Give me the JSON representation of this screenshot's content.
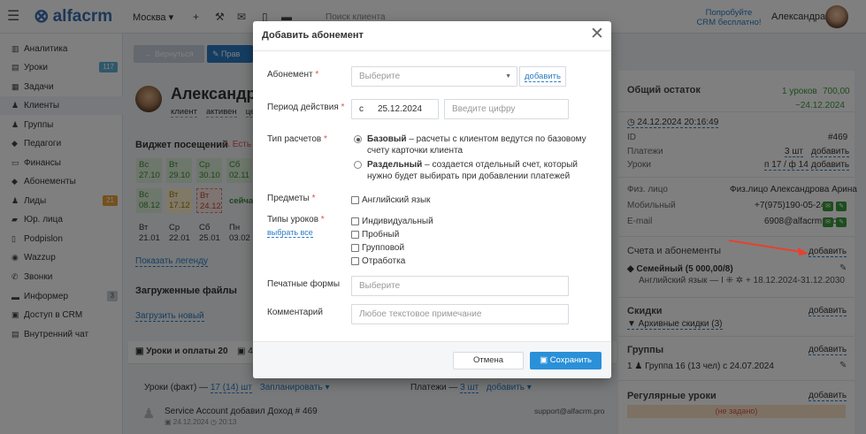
{
  "topbar": {
    "logo_text": "alfacrm",
    "city": "Москва ▾",
    "search_placeholder": "Поиск клиента",
    "try_free": "Попробуйте CRM бесплатно!",
    "user_name": "Александра"
  },
  "sidebar": {
    "items": [
      {
        "label": "Аналитика",
        "icon": "analytics-icon"
      },
      {
        "label": "Уроки",
        "icon": "lessons-icon",
        "badge": "117"
      },
      {
        "label": "Задачи",
        "icon": "tasks-icon"
      },
      {
        "label": "Клиенты",
        "icon": "clients-icon"
      },
      {
        "label": "Группы",
        "icon": "groups-icon"
      },
      {
        "label": "Педагоги",
        "icon": "teachers-icon"
      },
      {
        "label": "Финансы",
        "icon": "finance-icon"
      },
      {
        "label": "Абонементы",
        "icon": "subscriptions-icon"
      },
      {
        "label": "Лиды",
        "icon": "leads-icon",
        "badge": "21"
      },
      {
        "label": "Юр. лица",
        "icon": "legal-icon"
      },
      {
        "label": "Podpislon",
        "icon": "podpislon-icon"
      },
      {
        "label": "Wazzup",
        "icon": "wazzup-icon"
      },
      {
        "label": "Звонки",
        "icon": "calls-icon"
      },
      {
        "label": "Информер",
        "icon": "informer-icon",
        "badge": "3"
      },
      {
        "label": "Доступ в CRM",
        "icon": "lock-icon"
      },
      {
        "label": "Внутренний чат",
        "icon": "chat-icon"
      }
    ],
    "badge_colors": {
      "lessons": "#5fb0d4",
      "leads": "#e8a23a",
      "informer": "#c9ced6"
    }
  },
  "client": {
    "back_label": "← Вернуться",
    "edit_label": "✎ Прав",
    "name": "Александр",
    "tags": [
      "клиент",
      "активен",
      "цен"
    ],
    "widget_title": "Виджет посещений",
    "widget_warn": "⚠ Есть",
    "attendance": [
      {
        "d": "Вс",
        "n": "27.10"
      },
      {
        "d": "Вт",
        "n": "29.10"
      },
      {
        "d": "Ср",
        "n": "30.10"
      },
      {
        "d": "Сб",
        "n": "02.11"
      },
      {
        "d": "Вс",
        "n": "08.12"
      },
      {
        "d": "Вт",
        "n": "17.12"
      },
      {
        "d": "Вт",
        "n": "24.12"
      },
      {
        "d": "сейчас",
        "n": ""
      },
      {
        "d": "Вт",
        "n": "21.01"
      },
      {
        "d": "Ср",
        "n": "22.01"
      },
      {
        "d": "Сб",
        "n": "25.01"
      },
      {
        "d": "Пн",
        "n": "03.02"
      }
    ],
    "show_legend": "Показать легенду",
    "files_title": "Загруженные файлы",
    "upload_link": "Загрузить новый",
    "tab_lessons": "▣ Уроки и оплаты 20",
    "tab_other": "▣ 4",
    "lessons_fact_label": "Уроки (факт) —",
    "lessons_fact_value": "17 (14) шт",
    "planned": "Запланировать ▾",
    "payments_label": "Платежи —",
    "payments_value": "3 шт",
    "payments_add": "добавить ▾",
    "feed_text": "Service Account добавил Доход # 469",
    "feed_date": "▣ 24.12.2024  ◷ 20:13",
    "feed_email": "support@alfacrm.pro"
  },
  "right": {
    "balance_title": "Общий остаток",
    "balance_lessons": "1 уроков",
    "balance_amount": "700,00",
    "balance_date": "~24.12.2024",
    "updated": "◷ 24.12.2024 20:16:49",
    "rows": [
      {
        "k": "ID",
        "v": "#469"
      },
      {
        "k": "Платежи",
        "v": "3 шт",
        "a": "добавить"
      },
      {
        "k": "Уроки",
        "v": "п 17 / ф 14",
        "a": "добавить"
      },
      {
        "k": "Физ. лицо",
        "v": "Физ.лицо Александрова Арина"
      },
      {
        "k": "Мобильный",
        "v": "+7(975)190-05-24"
      },
      {
        "k": "E-mail",
        "v": "6908@alfacrm.pro"
      }
    ],
    "accounts_title": "Счета и абонементы",
    "accounts_add": "добавить",
    "family_account": "◆ Семейный (5 000,00/8)",
    "subscription_line": "Английский язык — I ⁜ ✲ + 18.12.2024-31.12.2030",
    "discounts_title": "Скидки",
    "discounts_add": "добавить",
    "archive_discounts": "▼ Архивные скидки (3)",
    "groups_title": "Группы",
    "groups_add": "добавить",
    "group_line": "1 ♟ Группа 16 (13 чел) с 24.07.2024",
    "regular_title": "Регулярные уроки",
    "regular_add": "добавить",
    "not_set": "(не задано)"
  },
  "modal": {
    "title": "Добавить абонемент",
    "subscription_label": "Абонемент",
    "subscription_placeholder": "Выберите",
    "subscription_add": "добавить",
    "period_label": "Период действия",
    "period_from": "с",
    "period_date": "25.12.2024",
    "period_number_placeholder": "Введите цифру",
    "calc_label": "Тип расчетов",
    "calc_basic_bold": "Базовый",
    "calc_basic_text": " – расчеты с клиентом ведутся по базовому счету карточки клиента",
    "calc_separate_bold": "Раздельный",
    "calc_separate_text": " – создается отдельный счет, который нужно будет выбирать при добавлении платежей",
    "subjects_label": "Предметы",
    "subject_english": "Английский язык",
    "lesson_types_label": "Типы уроков",
    "select_all": "выбрать все",
    "lesson_types": [
      "Индивидуальный",
      "Пробный",
      "Групповой",
      "Отработка"
    ],
    "print_forms_label": "Печатные формы",
    "print_forms_placeholder": "Выберите",
    "comment_label": "Комментарий",
    "comment_placeholder": "Любое текстовое примечание",
    "cancel_label": "Отмена",
    "save_label": "▣ Сохранить",
    "required_mark": "*"
  }
}
